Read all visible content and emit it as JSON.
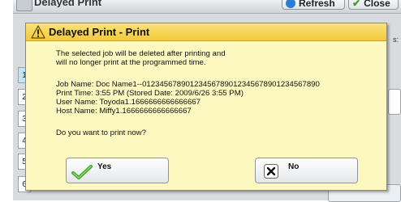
{
  "window": {
    "title": "Delayed Print",
    "refresh_label": "Refresh",
    "close_label": "Close",
    "side_label": "s:",
    "row_numbers": [
      "1",
      "2",
      "3",
      "4",
      "5",
      "6"
    ]
  },
  "dialog": {
    "title": "Delayed Print - Print",
    "message_line1": "The selected job will be deleted after printing and",
    "message_line2": "will no longer print at the programmed time.",
    "job_name": "Job Name: Doc Name1--01234567890123456789012345678901234567890",
    "print_time": "Print Time: 3:55 PM (Stored Date: 2009/6/26 3:55 PM)",
    "user_name": "User Name: Toyoda1.1666666666666667",
    "host_name": "Host Name: Miffy1.1666666666666667",
    "question": "Do you want to print now?",
    "yes_label": "Yes",
    "no_label": "No"
  },
  "colors": {
    "dialog_bg": "#fdf8bf",
    "titlebar": "#f2c93a",
    "selected_row": "#bfe4f6"
  }
}
